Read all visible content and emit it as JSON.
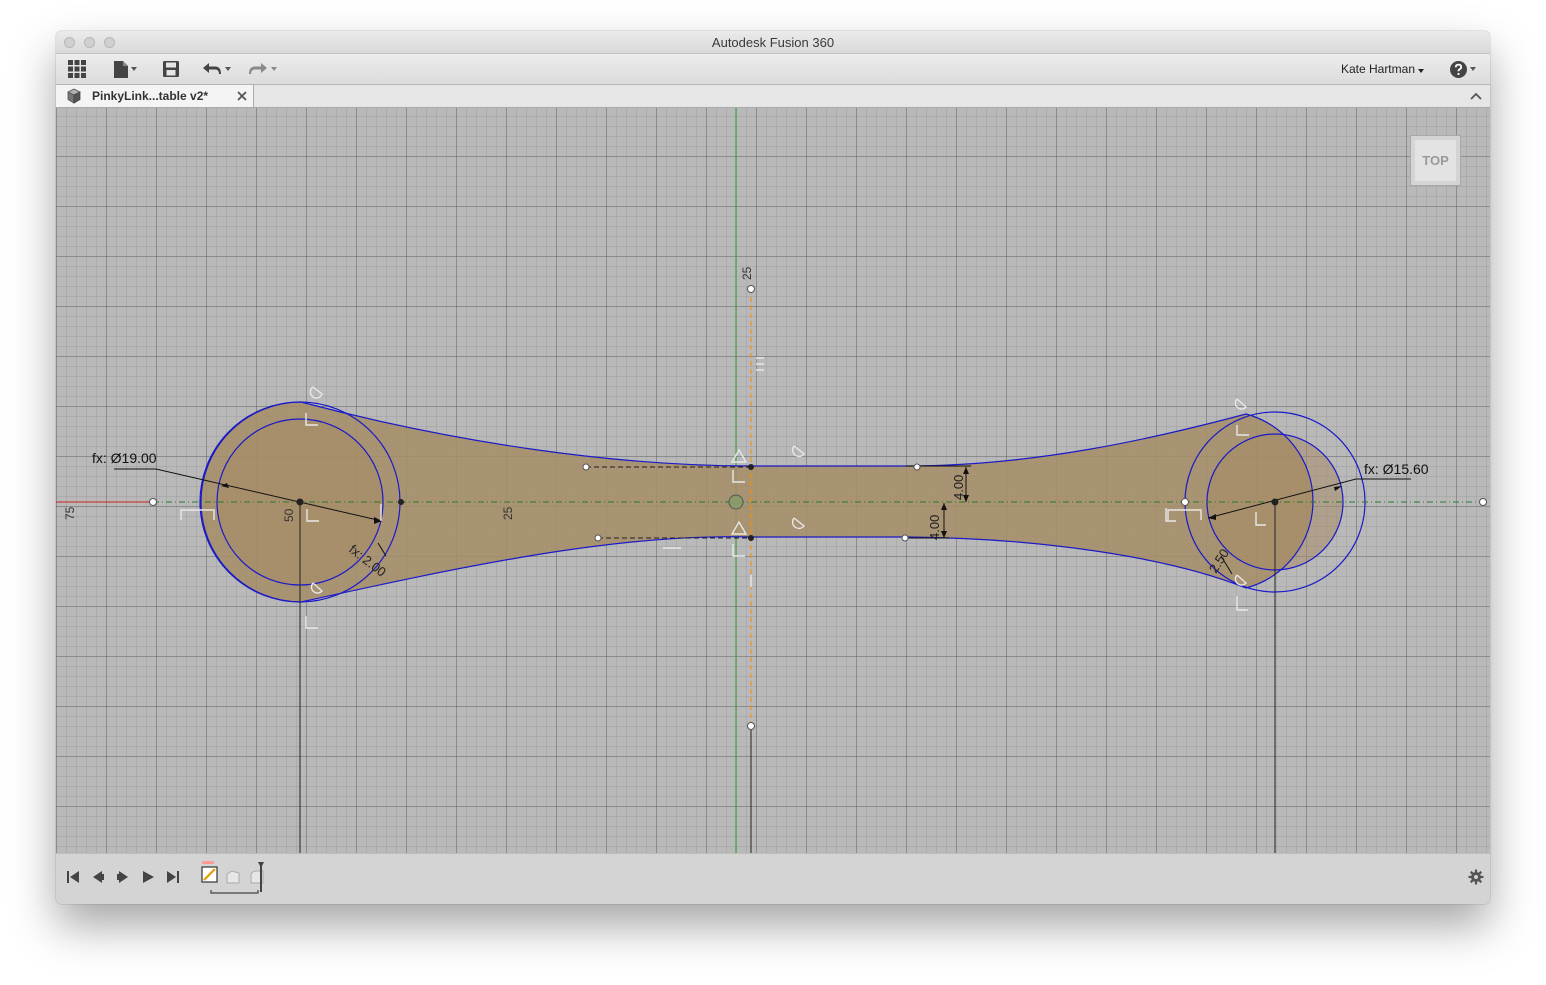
{
  "window": {
    "title": "Autodesk Fusion 360"
  },
  "toolbar": {
    "user_name": "Kate Hartman"
  },
  "document_tab": {
    "label": "PinkyLink...table v2*"
  },
  "viewcube": {
    "label": "TOP"
  },
  "sketch": {
    "dim_left_diameter": "fx: Ø19.00",
    "dim_right_diameter": "fx: Ø15.60",
    "dim_left_offset": "fx: 2.00",
    "dim_right_offset": "2.50",
    "dim_upper_half_width": "4.00",
    "dim_lower_half_width": "4.00",
    "ruler_left": "75",
    "ruler_top": "25",
    "ruler_middle": "25",
    "ruler_left_circle": "50"
  },
  "colors": {
    "profile_fill": "#a58d68",
    "sketch_line": "#1a1ac8",
    "x_axis": "#cc2222",
    "y_axis": "#2aa02a",
    "construction": "#ff8c00"
  }
}
